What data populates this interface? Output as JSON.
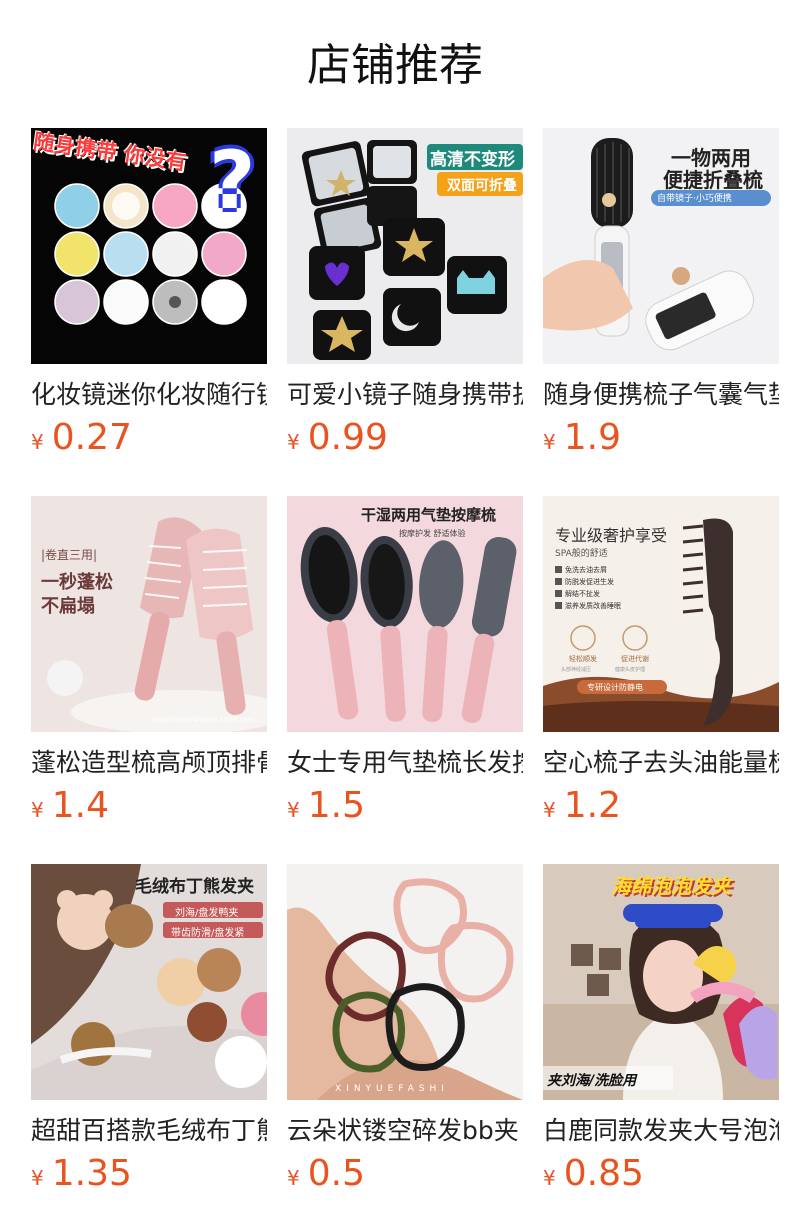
{
  "header": {
    "title": "店铺推荐"
  },
  "currency": "¥",
  "products": [
    {
      "name": "化妆镜迷你化妆随行镜",
      "price": "0.27",
      "overlay": [
        "随身携带 你没有",
        "?"
      ]
    },
    {
      "name": "可爱小镜子随身携带折叠",
      "price": "0.99",
      "overlay": [
        "高清不变形",
        "双面可折叠"
      ]
    },
    {
      "name": "随身便携梳子气囊气垫梳",
      "price": "1.9",
      "overlay": [
        "一物两用",
        "便捷折叠梳",
        "自带镜子·小巧便携"
      ]
    },
    {
      "name": "蓬松造型梳高颅顶排骨梳",
      "price": "1.4",
      "overlay": [
        "|卷直三用|",
        "一秒蓬松",
        "不扁塌",
        "shop7t06o04f0866.1688.com"
      ]
    },
    {
      "name": "女士专用气垫梳长发按摩梳",
      "price": "1.5",
      "overlay": [
        "干湿两用气垫按摩梳",
        "按摩护发  舒适体验"
      ]
    },
    {
      "name": "空心梳子去头油能量梳",
      "price": "1.2",
      "overlay": [
        "专业级奢护享受",
        "SPA般的舒适",
        "免洗去油去屑",
        "防脱发促进生发",
        "解结不扯发",
        "滋养发质改善睡眠",
        "轻松顺发",
        "促进代谢",
        "头部神经减压",
        "健康头皮护理",
        "专研设计防静电"
      ]
    },
    {
      "name": "超甜百搭款毛绒布丁熊发夹",
      "price": "1.35",
      "overlay": [
        "毛绒布丁熊发夹",
        "刘海/盘发鸭夹",
        "带齿防滑/盘发紧"
      ]
    },
    {
      "name": "云朵状镂空碎发bb夹",
      "price": "0.5",
      "overlay": [
        "XINYUEFASHI"
      ]
    },
    {
      "name": "白鹿同款发夹大号泡泡夹",
      "price": "0.85",
      "overlay": [
        "海绵泡泡发夹",
        "夹刘海/洗脸用"
      ]
    }
  ],
  "colors": {
    "price": "#e8531f",
    "title": "#111111",
    "name": "#222222"
  }
}
